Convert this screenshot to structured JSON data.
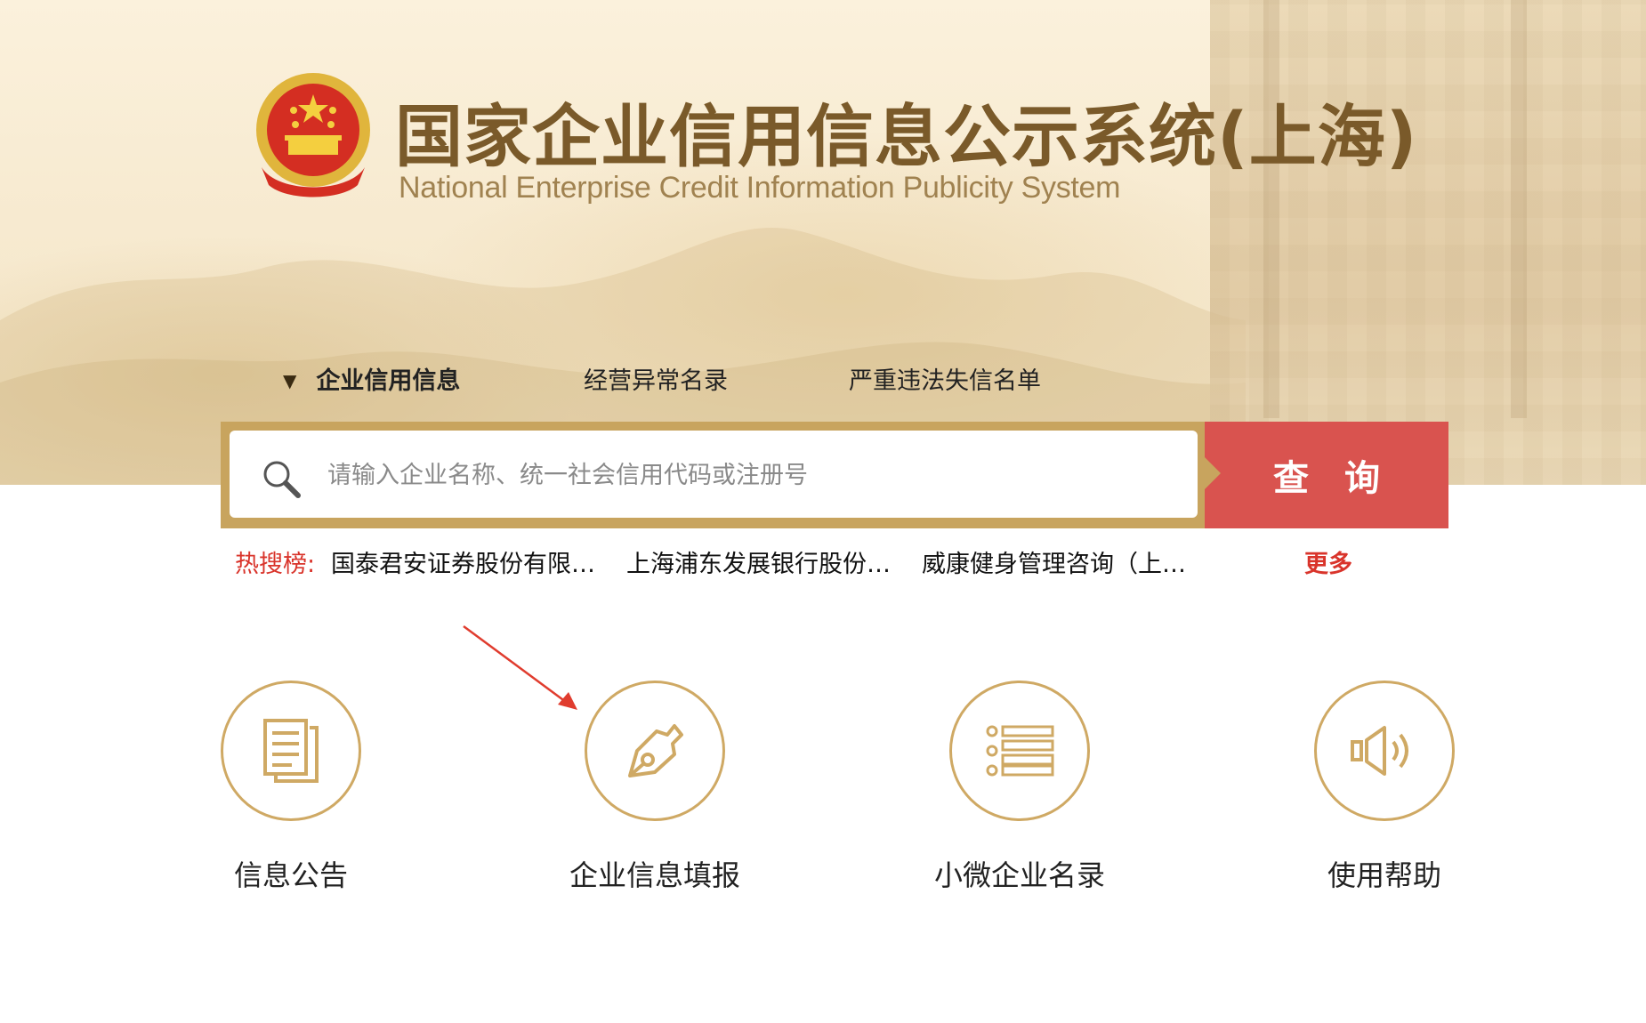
{
  "header": {
    "title_cn": "国家企业信用信息公示系统(上海)",
    "title_en": "National Enterprise Credit Information Publicity System",
    "emblem_icon": "national-emblem-icon"
  },
  "tabs": [
    {
      "label": "企业信用信息",
      "active": true
    },
    {
      "label": "经营异常名录",
      "active": false
    },
    {
      "label": "严重违法失信名单",
      "active": false
    }
  ],
  "search": {
    "placeholder": "请输入企业名称、统一社会信用代码或注册号",
    "value": "",
    "button_label": "查询"
  },
  "hot_search": {
    "label": "热搜榜:",
    "items": [
      "国泰君安证券股份有限…",
      "上海浦东发展银行股份…",
      "威康健身管理咨询（上…"
    ],
    "more_label": "更多"
  },
  "features": [
    {
      "label": "信息公告",
      "icon": "document-icon"
    },
    {
      "label": "企业信息填报",
      "icon": "pen-icon"
    },
    {
      "label": "小微企业名录",
      "icon": "list-icon"
    },
    {
      "label": "使用帮助",
      "icon": "speaker-icon"
    }
  ],
  "colors": {
    "gold": "#cfa964",
    "search_button": "#d9534f",
    "hot_label": "#d9342b",
    "title": "#7a5a2a"
  }
}
